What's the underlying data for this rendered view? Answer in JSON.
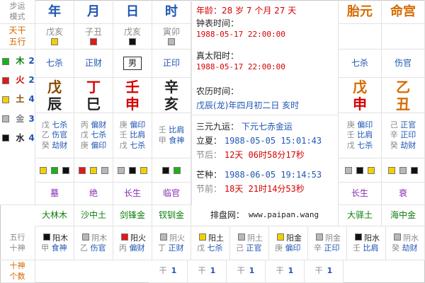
{
  "left": {
    "title_lines": [
      "步运",
      "模式"
    ],
    "tiangan_wuxing": [
      "天干",
      "五行"
    ],
    "wuxing_counts": [
      {
        "name": "木",
        "count": "2",
        "color": "#19b319"
      },
      {
        "name": "火",
        "count": "2",
        "color": "#e01919"
      },
      {
        "name": "土",
        "count": "4",
        "color": "#f2d000"
      },
      {
        "name": "金",
        "count": "3",
        "color": "#b8b8b8"
      },
      {
        "name": "水",
        "count": "4",
        "color": "#111111"
      }
    ],
    "bottom_labels": [
      "五行",
      "十神"
    ],
    "bottom_labels2": [
      "十神",
      "个数"
    ]
  },
  "columns": {
    "headers": [
      "年",
      "月",
      "日",
      "时"
    ],
    "ganzhi_small": [
      "戊亥",
      "子丑",
      "戊亥",
      "寅卯"
    ],
    "shishen_top": [
      "七杀",
      "正财",
      "男",
      "正印"
    ],
    "pillars": [
      {
        "stem": "戊",
        "branch": "辰"
      },
      {
        "stem": "丁",
        "branch": "巳"
      },
      {
        "stem": "壬",
        "branch": "申"
      },
      {
        "stem": "辛",
        "branch": "亥"
      }
    ],
    "canggan": [
      [
        {
          "g": "戊",
          "s": "七杀"
        },
        {
          "g": "乙",
          "s": "伤官"
        },
        {
          "g": "癸",
          "s": "劫财"
        }
      ],
      [
        {
          "g": "丙",
          "s": "偏财"
        },
        {
          "g": "戊",
          "s": "七杀"
        },
        {
          "g": "庚",
          "s": "偏印"
        }
      ],
      [
        {
          "g": "庚",
          "s": "偏印"
        },
        {
          "g": "壬",
          "s": "比肩"
        },
        {
          "g": "戊",
          "s": "七杀"
        }
      ],
      [
        {
          "g": "壬",
          "s": "比肩"
        },
        {
          "g": "甲",
          "s": "食神"
        }
      ]
    ],
    "changsheng": [
      "墓",
      "绝",
      "长生",
      "临官"
    ],
    "nayin": [
      "大林木",
      "沙中土",
      "剑锋金",
      "钗钏金"
    ]
  },
  "mid": {
    "age": "年龄：28 岁 7 个月 27 天",
    "clock_label": "钟表时间：",
    "clock_value": "1988-05-17 22:00:00",
    "solar_label": "真太阳时：",
    "solar_value": "1988-05-17 22:00:00",
    "lunar_label": "农历时间：",
    "lunar_value": "戊辰(龙)年四月初二日 亥时",
    "sanyuan_label": "三元九运：",
    "sanyuan_value": "下元七赤金运",
    "lixia_label": "立夏：",
    "lixia_value": "1988-05-05 15:01:43",
    "jiehou_label": "节后：",
    "jiehou_value": "12天 06时58分17秒",
    "mangzhong_label": "芒种：",
    "mangzhong_value": "1988-06-05 19:14:53",
    "jieqian_label": "节前：",
    "jieqian_value": "18天 21时14分53秒",
    "site_label": "排盘网：",
    "site_url": "www.paipan.wang"
  },
  "right": {
    "headers": [
      "胎元",
      "命宫"
    ],
    "ganzhi_small": [
      "",
      ""
    ],
    "shishen_top": [
      "七杀",
      "伤官"
    ],
    "pillars": [
      {
        "stem": "戊",
        "branch": "申"
      },
      {
        "stem": "乙",
        "branch": "丑"
      }
    ],
    "canggan": [
      [
        {
          "g": "庚",
          "s": "偏印"
        },
        {
          "g": "壬",
          "s": "比肩"
        },
        {
          "g": "戊",
          "s": "七杀"
        }
      ],
      [
        {
          "g": "己",
          "s": "正官"
        },
        {
          "g": "辛",
          "s": "正印"
        },
        {
          "g": "癸",
          "s": "劫财"
        }
      ]
    ],
    "changsheng": [
      "长生",
      "衰"
    ],
    "nayin": [
      "大驿土",
      "海中金"
    ]
  },
  "bottom_row": [
    {
      "a": "阳木",
      "b": "甲",
      "c": "食神",
      "sq": "black"
    },
    {
      "a": "阴木",
      "b": "乙",
      "c": "伤官",
      "sq": "gray"
    },
    {
      "a": "阳火",
      "b": "丙",
      "c": "偏财",
      "sq": "red"
    },
    {
      "a": "阴火",
      "b": "丁",
      "c": "正财",
      "sq": "gray"
    },
    {
      "a": "阳土",
      "b": "戊",
      "c": "七杀",
      "sq": "yellow"
    },
    {
      "a": "阴土",
      "b": "己",
      "c": "正官",
      "sq": "gray"
    },
    {
      "a": "阳金",
      "b": "庚",
      "c": "偏印",
      "sq": "yellow"
    },
    {
      "a": "阴金",
      "b": "辛",
      "c": "正印",
      "sq": "gray"
    },
    {
      "a": "阳水",
      "b": "壬",
      "c": "比肩",
      "sq": "black"
    },
    {
      "a": "阴水",
      "b": "癸",
      "c": "劫财",
      "sq": "gray"
    }
  ],
  "bottom_counts": [
    {
      "g": "干",
      "n": "1"
    },
    {
      "g": "干",
      "n": "1"
    },
    {
      "g": "干",
      "n": "1"
    },
    {
      "g": "干",
      "n": "1"
    },
    {
      "g": "干",
      "n": "1"
    }
  ]
}
